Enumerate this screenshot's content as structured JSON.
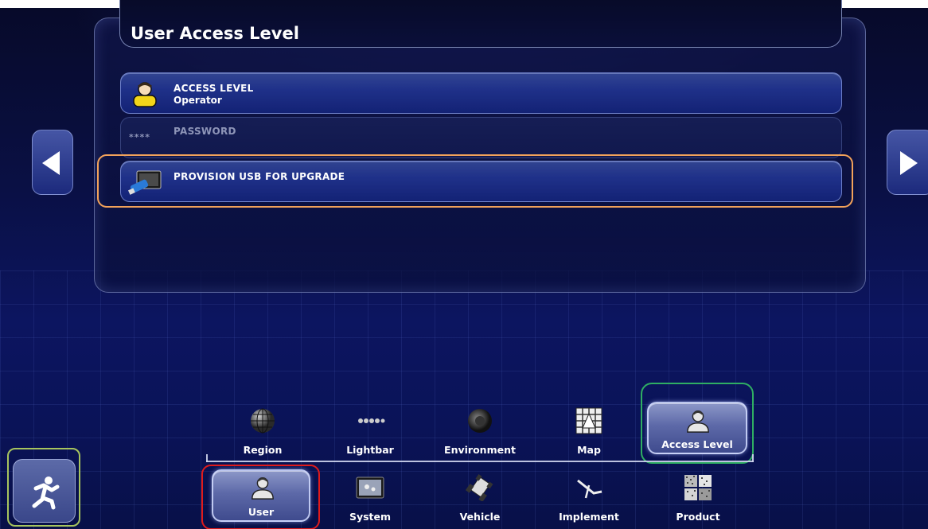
{
  "panel": {
    "title": "User Access Level",
    "rows": [
      {
        "label": "ACCESS LEVEL",
        "value": "Operator",
        "icon": "user-icon",
        "enabled": true
      },
      {
        "label": "PASSWORD",
        "prefix": "****",
        "icon": "password-icon",
        "enabled": false
      },
      {
        "label": "PROVISION USB FOR UPGRADE",
        "icon": "usb-drive-icon",
        "enabled": true
      }
    ]
  },
  "subtabs": [
    {
      "label": "Region",
      "icon": "globe-icon"
    },
    {
      "label": "Lightbar",
      "icon": "lightbar-icon"
    },
    {
      "label": "Environment",
      "icon": "speaker-icon"
    },
    {
      "label": "Map",
      "icon": "map-icon"
    },
    {
      "label": "Access Level",
      "icon": "user-icon",
      "selected": true
    }
  ],
  "maintabs": [
    {
      "label": "User",
      "icon": "user-icon",
      "selected": true
    },
    {
      "label": "System",
      "icon": "system-icon"
    },
    {
      "label": "Vehicle",
      "icon": "tractor-icon"
    },
    {
      "label": "Implement",
      "icon": "implement-icon"
    },
    {
      "label": "Product",
      "icon": "product-icon"
    }
  ],
  "colors": {
    "highlight_orange": "#f2a25a",
    "highlight_green": "#2fae63",
    "highlight_light_green": "#a7c45e",
    "highlight_red": "#e01b1b"
  }
}
